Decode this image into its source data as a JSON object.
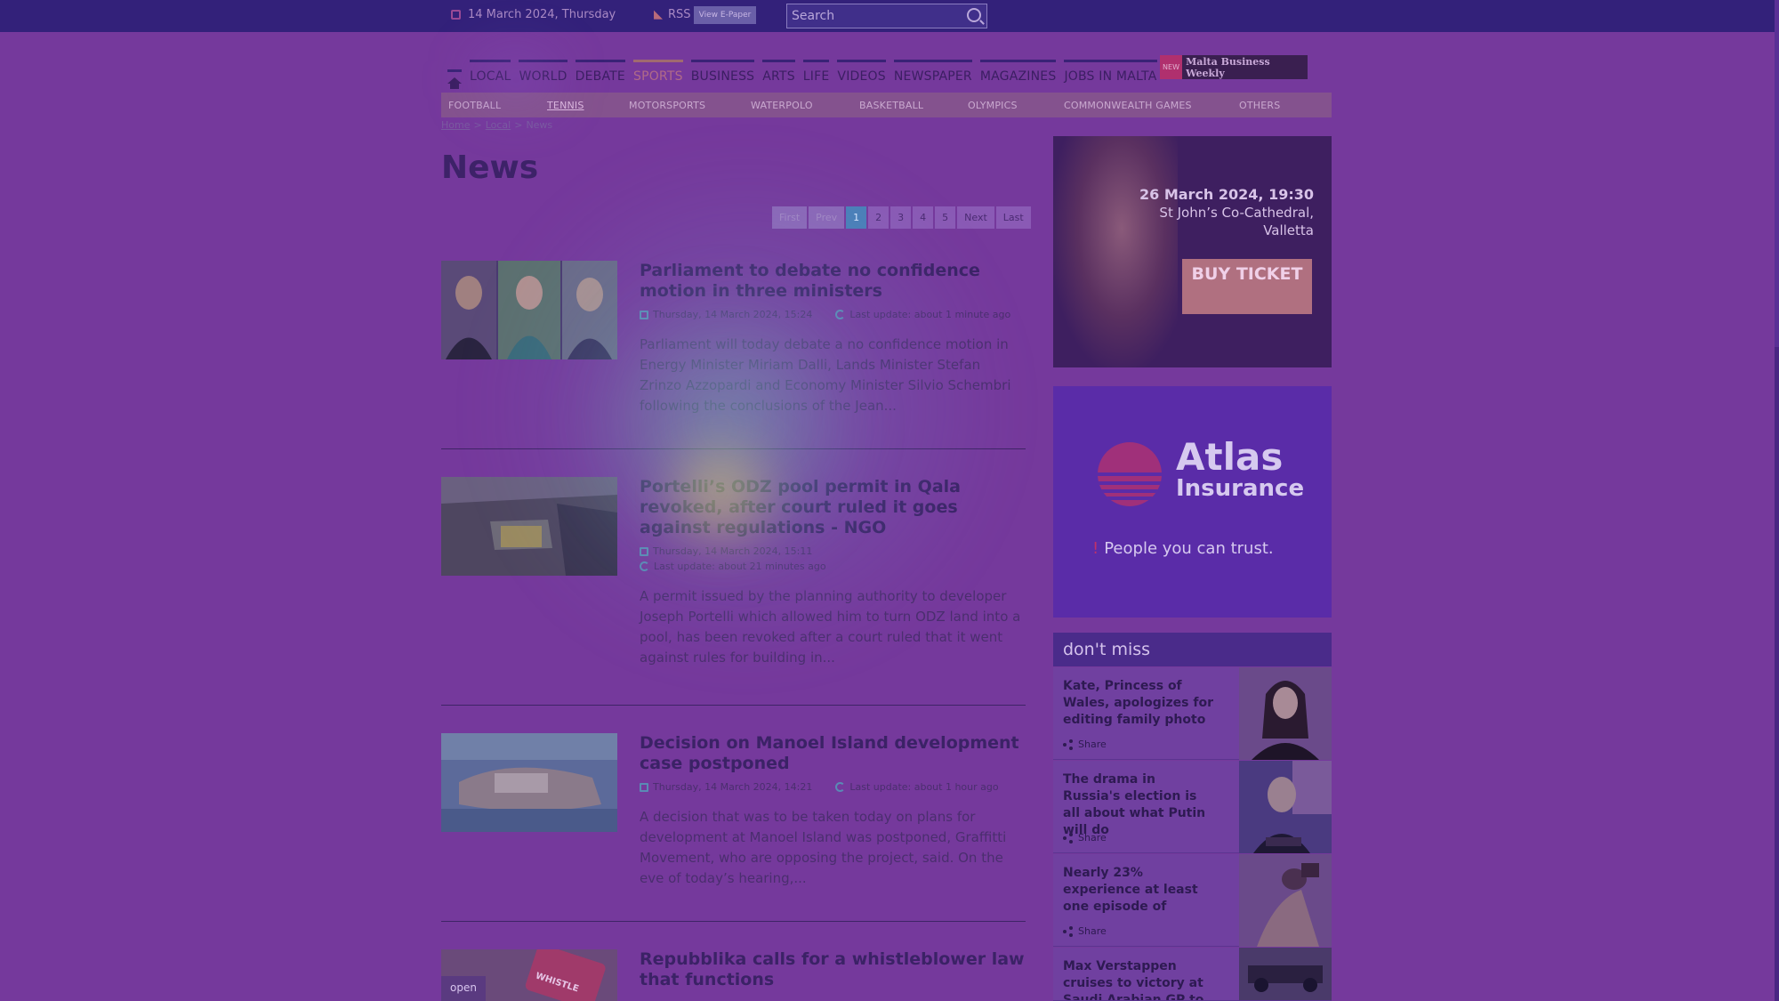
{
  "topbar": {
    "date": "14 March 2024, Thursday",
    "rss_label": "RSS",
    "epaper_label": "View E-Paper",
    "search_placeholder": "Search"
  },
  "nav": {
    "items": [
      "LOCAL",
      "WORLD",
      "DEBATE",
      "SPORTS",
      "BUSINESS",
      "ARTS",
      "LIFE",
      "VIDEOS",
      "NEWSPAPER",
      "MAGAZINES",
      "JOBS IN MALTA"
    ],
    "active": "SPORTS",
    "mbw_new": "NEW",
    "mbw_label": "Malta Business Weekly"
  },
  "subnav": {
    "items": [
      "FOOTBALL",
      "TENNIS",
      "MOTORSPORTS",
      "WATERPOLO",
      "BASKETBALL",
      "OLYMPICS",
      "COMMONWEALTH GAMES",
      "OTHERS"
    ],
    "active": "TENNIS"
  },
  "breadcrumb": {
    "home": "Home",
    "local": "Local",
    "current": "News",
    "sep": ">"
  },
  "page_title": "News",
  "pager": [
    "First",
    "Prev",
    "1",
    "2",
    "3",
    "4",
    "5",
    "Next",
    "Last"
  ],
  "articles": [
    {
      "title": "Parliament to debate no confidence motion in three ministers",
      "date": "Thursday, 14 March 2024, 15:24",
      "updated": "Last update: about 1 minute ago",
      "excerpt": "Parliament will today debate a no confidence motion in Energy Minister Miriam Dalli, Lands Minister Stefan Zrinzo Azzopardi and Economy Minister Silvio Schembri following the conclusions of the Jean..."
    },
    {
      "title": "Portelli’s ODZ pool permit in Qala revoked, after court ruled it goes against regulations - NGO",
      "date": "Thursday, 14 March 2024, 15:11",
      "updated": "Last update: about 21 minutes ago",
      "excerpt": "A permit issued by the planning authority to developer Joseph Portelli which allowed him to turn ODZ land into a pool, has been revoked after a court ruled that it went against rules for building in..."
    },
    {
      "title": "Decision on Manoel Island development case postponed",
      "date": "Thursday, 14 March 2024, 14:21",
      "updated": "Last update: about 1 hour ago",
      "excerpt": "A decision that was to be taken today on plans for development at Manoel Island was postponed, Graffitti Movement, who are opposing the project, said. On the eve of today’s hearing,..."
    },
    {
      "title": "Repubblika calls for a whistleblower law that functions",
      "thumb_badge": "open",
      "thumb_text": "WHISTLE"
    }
  ],
  "ad1": {
    "when": "26 March 2024, 19:30",
    "where": "St John’s Co-Cathedral, Valletta",
    "cta": "BUY TICKET"
  },
  "ad2": {
    "brand": "Atlas",
    "brand2": "Insurance",
    "tag": "People you can trust."
  },
  "dont_miss": {
    "title": "don't miss",
    "items": [
      {
        "text": "Kate, Princess of Wales, apologizes for editing family photo",
        "share": "Share"
      },
      {
        "text": "The drama in Russia's election is all about what Putin will do",
        "share": "Share"
      },
      {
        "text": "Nearly 23% experience at least one episode of",
        "share": "Share"
      },
      {
        "text": "Max Verstappen cruises to victory at Saudi Arabian GP to"
      }
    ]
  },
  "colors": {
    "overlay": "#75399c",
    "active_page": "#4a7fb8",
    "accent_red": "#b0306e"
  }
}
